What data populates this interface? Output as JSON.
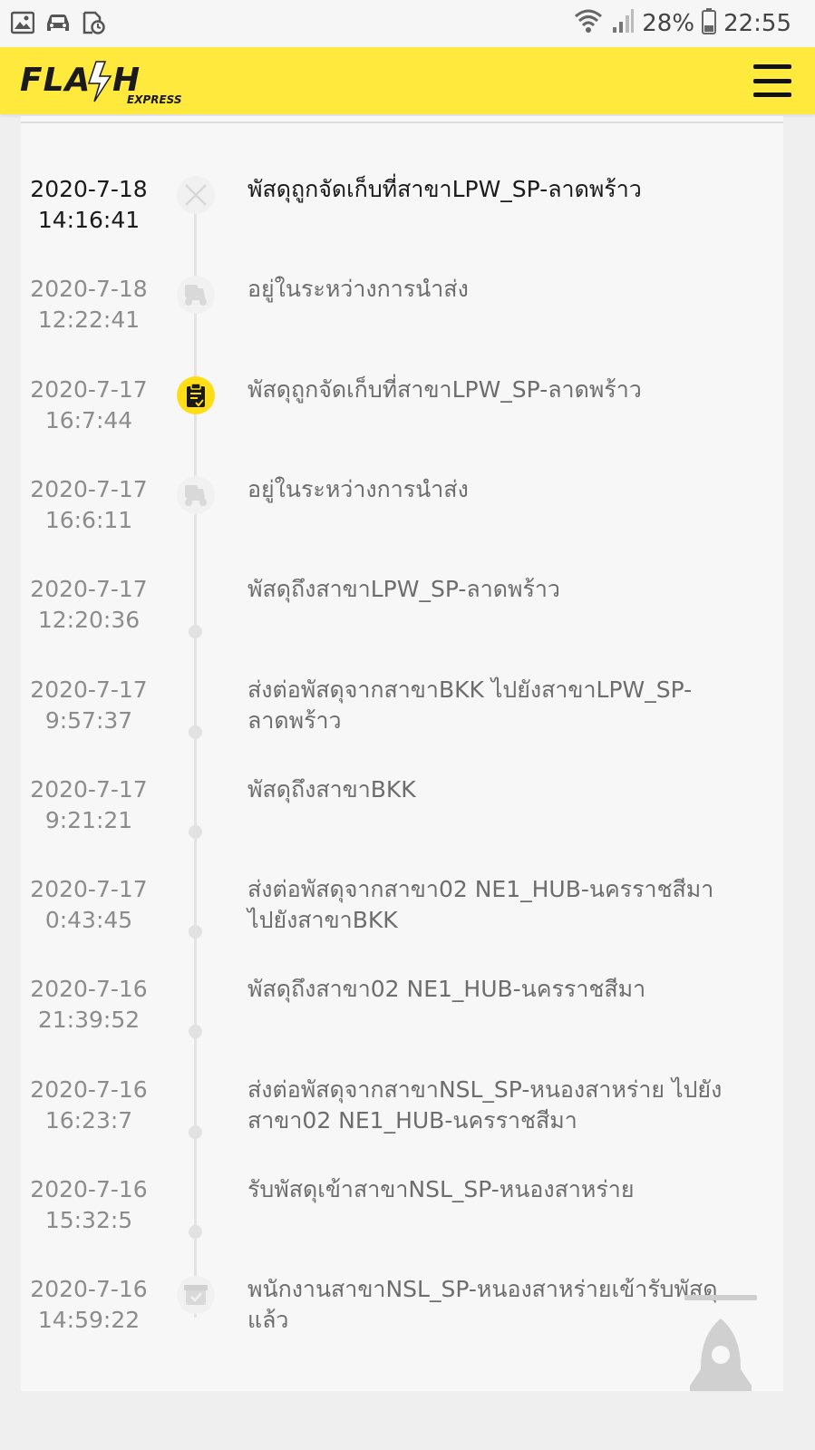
{
  "status_bar": {
    "icons": [
      "image-icon",
      "car-icon",
      "clock-file-icon"
    ],
    "wifi_icon": "wifi-icon",
    "signal_icon": "signal-icon",
    "battery_percent": "28%",
    "battery_icon": "battery-icon",
    "time": "22:55"
  },
  "header": {
    "logo_text": "FLASH EXPRESS",
    "menu_icon": "hamburger-menu-icon",
    "brand_color": "#ffe93d"
  },
  "timeline": {
    "entries": [
      {
        "date": "2020-7-18",
        "time": "14:16:41",
        "status": "พัสดุถูกจัดเก็บที่สาขาLPW_SP-ลาดพร้าว",
        "marker": "close-icon"
      },
      {
        "date": "2020-7-18",
        "time": "12:22:41",
        "status": "อยู่ในระหว่างการนำส่ง",
        "marker": "delivery-scooter-icon"
      },
      {
        "date": "2020-7-17",
        "time": "16:7:44",
        "status": "พัสดุถูกจัดเก็บที่สาขาLPW_SP-ลาดพร้าว",
        "marker": "clipboard-check-icon"
      },
      {
        "date": "2020-7-17",
        "time": "16:6:11",
        "status": "อยู่ในระหว่างการนำส่ง",
        "marker": "delivery-scooter-icon"
      },
      {
        "date": "2020-7-17",
        "time": "12:20:36",
        "status": "พัสดุถึงสาขาLPW_SP-ลาดพร้าว",
        "marker": "dot"
      },
      {
        "date": "2020-7-17",
        "time": "9:57:37",
        "status": "ส่งต่อพัสดุจากสาขาBKK ไปยังสาขาLPW_SP-ลาดพร้าว",
        "marker": "dot"
      },
      {
        "date": "2020-7-17",
        "time": "9:21:21",
        "status": "พัสดุถึงสาขาBKK",
        "marker": "dot"
      },
      {
        "date": "2020-7-17",
        "time": "0:43:45",
        "status": "ส่งต่อพัสดุจากสาขา02 NE1_HUB-นครราชสีมา ไปยังสาขาBKK",
        "marker": "dot"
      },
      {
        "date": "2020-7-16",
        "time": "21:39:52",
        "status": "พัสดุถึงสาขา02 NE1_HUB-นครราชสีมา",
        "marker": "dot"
      },
      {
        "date": "2020-7-16",
        "time": "16:23:7",
        "status": "ส่งต่อพัสดุจากสาขาNSL_SP-หนองสาหร่าย ไปยังสาขา02 NE1_HUB-นครราชสีมา",
        "marker": "dot"
      },
      {
        "date": "2020-7-16",
        "time": "15:32:5",
        "status": "รับพัสดุเข้าสาขาNSL_SP-หนองสาหร่าย",
        "marker": "dot"
      },
      {
        "date": "2020-7-16",
        "time": "14:59:22",
        "status": "พนักงานสาขาNSL_SP-หนองสาหร่ายเข้ารับพัสดุแล้ว",
        "marker": "package-check-icon"
      }
    ]
  },
  "floating_button": {
    "icon": "rocket-icon"
  }
}
